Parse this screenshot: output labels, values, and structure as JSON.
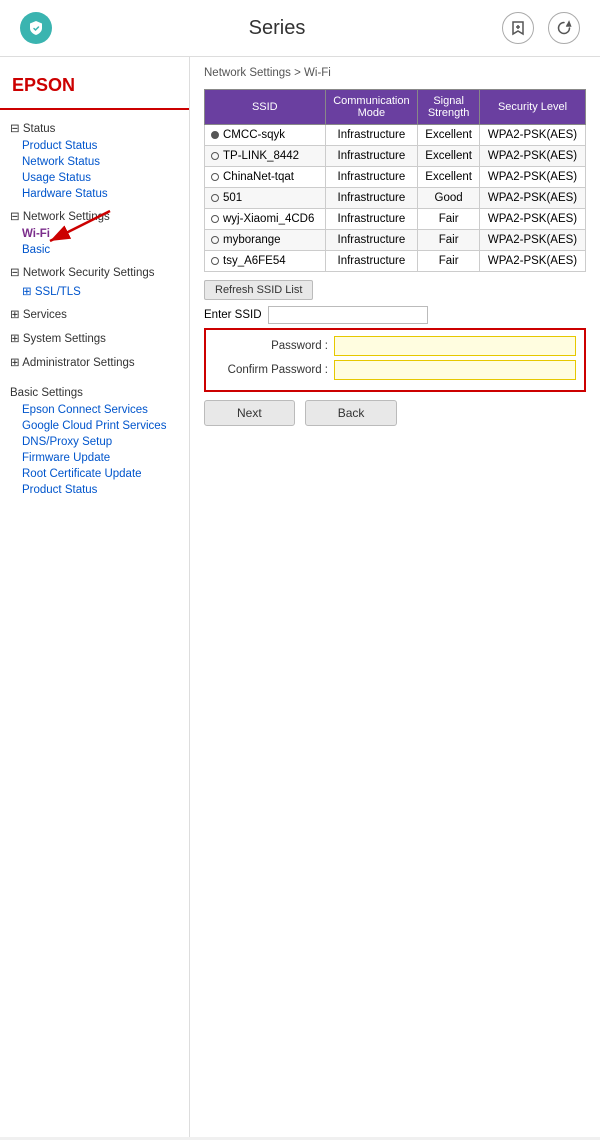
{
  "topbar": {
    "title": "Series",
    "add_icon": "bookmark-plus-icon",
    "refresh_icon": "refresh-icon"
  },
  "sidebar": {
    "logo": "EPSON",
    "sections": [
      {
        "header": "⊟ Status",
        "links": [
          {
            "label": "Product Status",
            "active": false,
            "id": "product-status"
          },
          {
            "label": "Network Status",
            "active": false,
            "id": "network-status"
          },
          {
            "label": "Usage Status",
            "active": false,
            "id": "usage-status"
          },
          {
            "label": "Hardware Status",
            "active": false,
            "id": "hardware-status"
          }
        ]
      },
      {
        "header": "⊟ Network Settings",
        "links": [
          {
            "label": "Wi-Fi",
            "active": true,
            "id": "wifi"
          },
          {
            "label": "Basic",
            "active": false,
            "id": "basic"
          }
        ]
      },
      {
        "header": "⊟ Network Security Settings",
        "links": [
          {
            "label": "⊞ SSL/TLS",
            "active": false,
            "id": "ssl-tls"
          }
        ]
      },
      {
        "header": "⊞ Services",
        "links": []
      },
      {
        "header": "⊞ System Settings",
        "links": []
      },
      {
        "header": "⊞ Administrator Settings",
        "links": []
      }
    ],
    "basic_settings": {
      "header": "Basic Settings",
      "links": [
        {
          "label": "Epson Connect Services",
          "id": "epson-connect"
        },
        {
          "label": "Google Cloud Print Services",
          "id": "google-cloud"
        },
        {
          "label": "DNS/Proxy Setup",
          "id": "dns-proxy"
        },
        {
          "label": "Firmware Update",
          "id": "firmware-update"
        },
        {
          "label": "Root Certificate Update",
          "id": "root-cert"
        },
        {
          "label": "Product Status",
          "id": "product-status-2"
        }
      ]
    }
  },
  "content": {
    "breadcrumb": "Network Settings > Wi-Fi",
    "table_headers": [
      "SSID",
      "Communication Mode",
      "Signal Strength",
      "Security Level"
    ],
    "networks": [
      {
        "selected": true,
        "ssid": "CMCC-sqyk",
        "mode": "Infrastructure",
        "signal": "Excellent",
        "security": "WPA2-PSK(AES)"
      },
      {
        "selected": false,
        "ssid": "TP-LINK_8442",
        "mode": "Infrastructure",
        "signal": "Excellent",
        "security": "WPA2-PSK(AES)"
      },
      {
        "selected": false,
        "ssid": "ChinaNet-tqat",
        "mode": "Infrastructure",
        "signal": "Excellent",
        "security": "WPA2-PSK(AES)"
      },
      {
        "selected": false,
        "ssid": "501",
        "mode": "Infrastructure",
        "signal": "Good",
        "security": "WPA2-PSK(AES)"
      },
      {
        "selected": false,
        "ssid": "wyj-Xiaomi_4CD6",
        "mode": "Infrastructure",
        "signal": "Fair",
        "security": "WPA2-PSK(AES)"
      },
      {
        "selected": false,
        "ssid": "myborange",
        "mode": "Infrastructure",
        "signal": "Fair",
        "security": "WPA2-PSK(AES)"
      },
      {
        "selected": false,
        "ssid": "tsy_A6FE54",
        "mode": "Infrastructure",
        "signal": "Fair",
        "security": "WPA2-PSK(AES)"
      }
    ],
    "refresh_btn": "Refresh SSID List",
    "enter_ssid_label": "Enter SSID",
    "password_label": "Password :",
    "confirm_password_label": "Confirm Password :",
    "next_btn": "Next",
    "back_btn": "Back"
  }
}
